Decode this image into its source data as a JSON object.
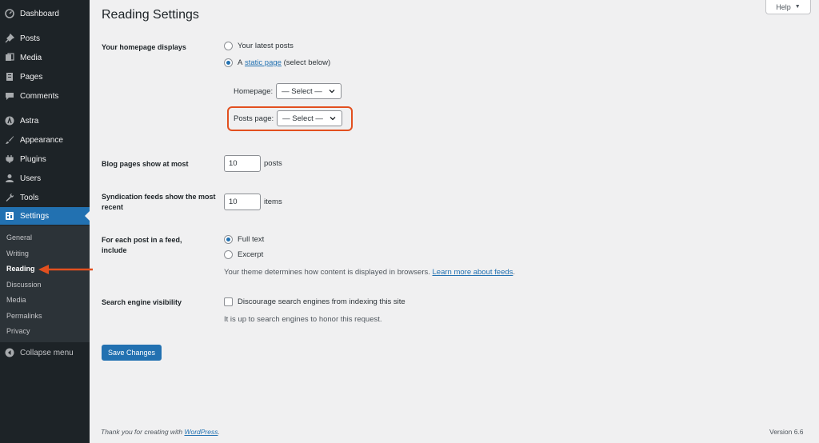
{
  "sidebar": {
    "items": [
      {
        "label": "Dashboard",
        "icon": "dashboard-icon"
      },
      {
        "label": "Posts",
        "icon": "pin-icon"
      },
      {
        "label": "Media",
        "icon": "media-icon"
      },
      {
        "label": "Pages",
        "icon": "pages-icon"
      },
      {
        "label": "Comments",
        "icon": "comments-icon"
      },
      {
        "label": "Astra",
        "icon": "astra-icon"
      },
      {
        "label": "Appearance",
        "icon": "brush-icon"
      },
      {
        "label": "Plugins",
        "icon": "plug-icon"
      },
      {
        "label": "Users",
        "icon": "users-icon"
      },
      {
        "label": "Tools",
        "icon": "wrench-icon"
      },
      {
        "label": "Settings",
        "icon": "settings-icon"
      }
    ],
    "submenu": [
      "General",
      "Writing",
      "Reading",
      "Discussion",
      "Media",
      "Permalinks",
      "Privacy"
    ],
    "collapse_label": "Collapse menu"
  },
  "header": {
    "title": "Reading Settings",
    "help_label": "Help"
  },
  "homepage": {
    "label": "Your homepage displays",
    "option_latest": "Your latest posts",
    "option_static_prefix": "A",
    "option_static_link": "static page",
    "option_static_suffix": "(select below)",
    "homepage_label": "Homepage:",
    "homepage_value": "— Select —",
    "posts_page_label": "Posts page:",
    "posts_page_value": "— Select —"
  },
  "blog_pages": {
    "label": "Blog pages show at most",
    "value": "10",
    "unit": "posts"
  },
  "syndication": {
    "label": "Syndication feeds show the most recent",
    "value": "10",
    "unit": "items"
  },
  "feed_content": {
    "label": "For each post in a feed, include",
    "option_full": "Full text",
    "option_excerpt": "Excerpt",
    "description": "Your theme determines how content is displayed in browsers.",
    "learn_more": "Learn more about feeds"
  },
  "search_visibility": {
    "label": "Search engine visibility",
    "checkbox_label": "Discourage search engines from indexing this site",
    "description": "It is up to search engines to honor this request."
  },
  "save_label": "Save Changes",
  "footer": {
    "thanks_prefix": "Thank you for creating with",
    "wordpress_link": "WordPress",
    "version": "Version 6.6"
  },
  "colors": {
    "sidebar_bg": "#1d2327",
    "accent": "#2271b1",
    "highlight": "#e2501f"
  }
}
